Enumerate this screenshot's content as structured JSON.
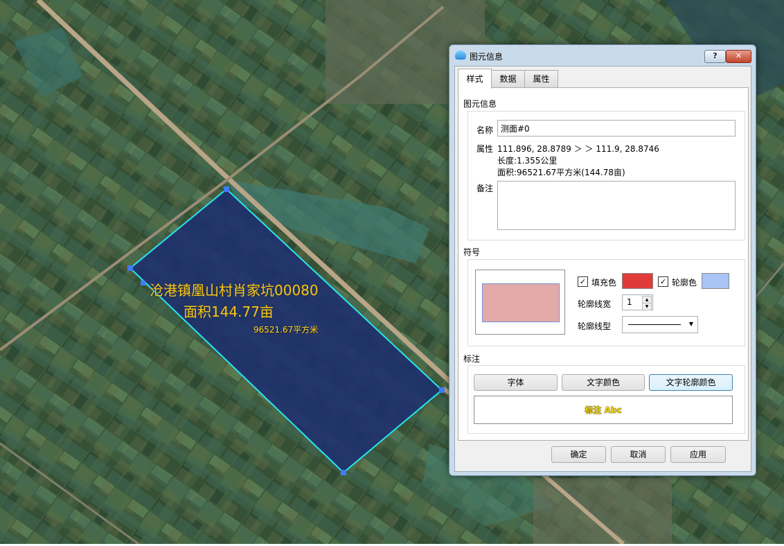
{
  "map": {
    "polygon_label_line1": "沧港镇凰山村肖家坑00080",
    "polygon_label_line2": "面积144.77亩",
    "polygon_area_label": "96521.67平方米"
  },
  "dialog": {
    "title": "图元信息",
    "help_label": "?",
    "close_label": "✕",
    "tabs": [
      "样式",
      "数据",
      "属性"
    ],
    "info_section": "图元信息",
    "name_label": "名称",
    "name_value": "测面#0",
    "attr_label": "属性",
    "attr_coords": "111.896, 28.8789 ＞ ＞ 111.9, 28.8746",
    "attr_length": "长度:1.355公里",
    "attr_area": "面积:96521.67平方米(144.78亩)",
    "note_label": "备注",
    "note_value": "",
    "symbol_section": "符号",
    "fill_checked": true,
    "fill_label": "填充色",
    "fill_color": "#e03a3a",
    "outline_checked": true,
    "outline_label": "轮廓色",
    "outline_color": "#a9c4f5",
    "preview_fill": "#e4aaaa",
    "preview_stroke": "#6f8fd8",
    "line_width_label": "轮廓线宽",
    "line_width_value": "1",
    "line_style_label": "轮廓线型",
    "label_section": "标注",
    "font_button": "字体",
    "text_color_button": "文字颜色",
    "text_outline_button": "文字轮廓颜色",
    "label_preview": "标注 Abc",
    "label_preview_color": "#f2d400",
    "ok_button": "确定",
    "cancel_button": "取消",
    "apply_button": "应用"
  },
  "colors": {
    "polygon_fill": "#1e2f6e",
    "polygon_stroke": "#27e6f0",
    "vertex": "#3f7df5",
    "label": "#f5c518"
  }
}
